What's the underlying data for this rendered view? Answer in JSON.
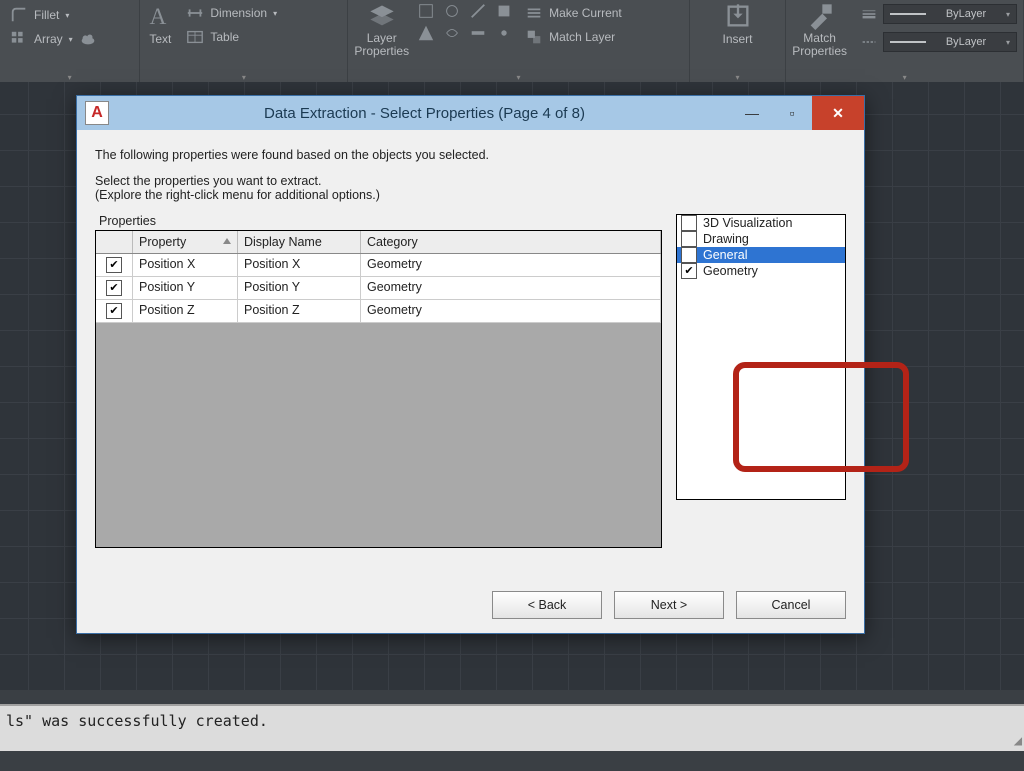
{
  "ribbon": {
    "fillet_label": "Fillet",
    "array_label": "Array",
    "text_label": "Text",
    "dimension_label": "Dimension",
    "table_label": "Table",
    "layer_props_label": "Layer\nProperties",
    "make_current_label": "Make Current",
    "match_layer_label": "Match Layer",
    "insert_label": "Insert",
    "match_props_label": "Match\nProperties",
    "bylayer1": "ByLayer",
    "bylayer2": "ByLayer"
  },
  "dialog": {
    "title": "Data Extraction - Select Properties (Page 4 of 8)",
    "intro1": "The following properties were found based on the objects you selected.",
    "intro2a": "Select the properties you want to extract.",
    "intro2b": "(Explore the right-click menu for additional options.)",
    "properties_group": "Properties",
    "headers": {
      "property": "Property",
      "display": "Display Name",
      "category": "Category"
    },
    "rows": [
      {
        "checked": true,
        "property": "Position X",
        "display": "Position X",
        "category": "Geometry"
      },
      {
        "checked": true,
        "property": "Position Y",
        "display": "Position Y",
        "category": "Geometry"
      },
      {
        "checked": true,
        "property": "Position Z",
        "display": "Position Z",
        "category": "Geometry"
      }
    ],
    "categories": [
      {
        "label": "3D Visualization",
        "checked": false,
        "selected": false
      },
      {
        "label": "Drawing",
        "checked": false,
        "selected": false
      },
      {
        "label": "General",
        "checked": false,
        "selected": true
      },
      {
        "label": "Geometry",
        "checked": true,
        "selected": false
      }
    ],
    "buttons": {
      "back": "< Back",
      "next": "Next >",
      "cancel": "Cancel"
    }
  },
  "cmdline": {
    "text": "ls\" was successfully created."
  }
}
